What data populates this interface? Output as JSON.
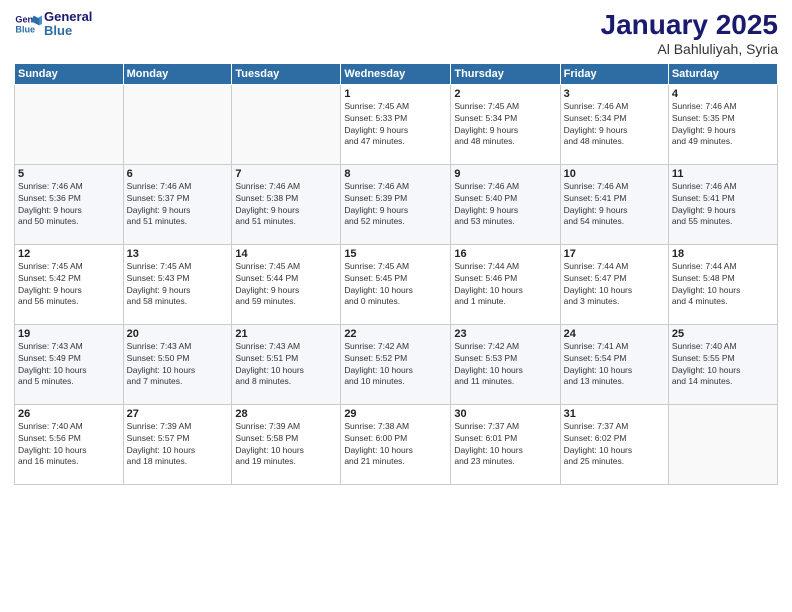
{
  "header": {
    "logo_line1": "General",
    "logo_line2": "Blue",
    "month": "January 2025",
    "location": "Al Bahluliyah, Syria"
  },
  "weekdays": [
    "Sunday",
    "Monday",
    "Tuesday",
    "Wednesday",
    "Thursday",
    "Friday",
    "Saturday"
  ],
  "weeks": [
    [
      {
        "day": "",
        "info": ""
      },
      {
        "day": "",
        "info": ""
      },
      {
        "day": "",
        "info": ""
      },
      {
        "day": "1",
        "info": "Sunrise: 7:45 AM\nSunset: 5:33 PM\nDaylight: 9 hours\nand 47 minutes."
      },
      {
        "day": "2",
        "info": "Sunrise: 7:45 AM\nSunset: 5:34 PM\nDaylight: 9 hours\nand 48 minutes."
      },
      {
        "day": "3",
        "info": "Sunrise: 7:46 AM\nSunset: 5:34 PM\nDaylight: 9 hours\nand 48 minutes."
      },
      {
        "day": "4",
        "info": "Sunrise: 7:46 AM\nSunset: 5:35 PM\nDaylight: 9 hours\nand 49 minutes."
      }
    ],
    [
      {
        "day": "5",
        "info": "Sunrise: 7:46 AM\nSunset: 5:36 PM\nDaylight: 9 hours\nand 50 minutes."
      },
      {
        "day": "6",
        "info": "Sunrise: 7:46 AM\nSunset: 5:37 PM\nDaylight: 9 hours\nand 51 minutes."
      },
      {
        "day": "7",
        "info": "Sunrise: 7:46 AM\nSunset: 5:38 PM\nDaylight: 9 hours\nand 51 minutes."
      },
      {
        "day": "8",
        "info": "Sunrise: 7:46 AM\nSunset: 5:39 PM\nDaylight: 9 hours\nand 52 minutes."
      },
      {
        "day": "9",
        "info": "Sunrise: 7:46 AM\nSunset: 5:40 PM\nDaylight: 9 hours\nand 53 minutes."
      },
      {
        "day": "10",
        "info": "Sunrise: 7:46 AM\nSunset: 5:41 PM\nDaylight: 9 hours\nand 54 minutes."
      },
      {
        "day": "11",
        "info": "Sunrise: 7:46 AM\nSunset: 5:41 PM\nDaylight: 9 hours\nand 55 minutes."
      }
    ],
    [
      {
        "day": "12",
        "info": "Sunrise: 7:45 AM\nSunset: 5:42 PM\nDaylight: 9 hours\nand 56 minutes."
      },
      {
        "day": "13",
        "info": "Sunrise: 7:45 AM\nSunset: 5:43 PM\nDaylight: 9 hours\nand 58 minutes."
      },
      {
        "day": "14",
        "info": "Sunrise: 7:45 AM\nSunset: 5:44 PM\nDaylight: 9 hours\nand 59 minutes."
      },
      {
        "day": "15",
        "info": "Sunrise: 7:45 AM\nSunset: 5:45 PM\nDaylight: 10 hours\nand 0 minutes."
      },
      {
        "day": "16",
        "info": "Sunrise: 7:44 AM\nSunset: 5:46 PM\nDaylight: 10 hours\nand 1 minute."
      },
      {
        "day": "17",
        "info": "Sunrise: 7:44 AM\nSunset: 5:47 PM\nDaylight: 10 hours\nand 3 minutes."
      },
      {
        "day": "18",
        "info": "Sunrise: 7:44 AM\nSunset: 5:48 PM\nDaylight: 10 hours\nand 4 minutes."
      }
    ],
    [
      {
        "day": "19",
        "info": "Sunrise: 7:43 AM\nSunset: 5:49 PM\nDaylight: 10 hours\nand 5 minutes."
      },
      {
        "day": "20",
        "info": "Sunrise: 7:43 AM\nSunset: 5:50 PM\nDaylight: 10 hours\nand 7 minutes."
      },
      {
        "day": "21",
        "info": "Sunrise: 7:43 AM\nSunset: 5:51 PM\nDaylight: 10 hours\nand 8 minutes."
      },
      {
        "day": "22",
        "info": "Sunrise: 7:42 AM\nSunset: 5:52 PM\nDaylight: 10 hours\nand 10 minutes."
      },
      {
        "day": "23",
        "info": "Sunrise: 7:42 AM\nSunset: 5:53 PM\nDaylight: 10 hours\nand 11 minutes."
      },
      {
        "day": "24",
        "info": "Sunrise: 7:41 AM\nSunset: 5:54 PM\nDaylight: 10 hours\nand 13 minutes."
      },
      {
        "day": "25",
        "info": "Sunrise: 7:40 AM\nSunset: 5:55 PM\nDaylight: 10 hours\nand 14 minutes."
      }
    ],
    [
      {
        "day": "26",
        "info": "Sunrise: 7:40 AM\nSunset: 5:56 PM\nDaylight: 10 hours\nand 16 minutes."
      },
      {
        "day": "27",
        "info": "Sunrise: 7:39 AM\nSunset: 5:57 PM\nDaylight: 10 hours\nand 18 minutes."
      },
      {
        "day": "28",
        "info": "Sunrise: 7:39 AM\nSunset: 5:58 PM\nDaylight: 10 hours\nand 19 minutes."
      },
      {
        "day": "29",
        "info": "Sunrise: 7:38 AM\nSunset: 6:00 PM\nDaylight: 10 hours\nand 21 minutes."
      },
      {
        "day": "30",
        "info": "Sunrise: 7:37 AM\nSunset: 6:01 PM\nDaylight: 10 hours\nand 23 minutes."
      },
      {
        "day": "31",
        "info": "Sunrise: 7:37 AM\nSunset: 6:02 PM\nDaylight: 10 hours\nand 25 minutes."
      },
      {
        "day": "",
        "info": ""
      }
    ]
  ]
}
